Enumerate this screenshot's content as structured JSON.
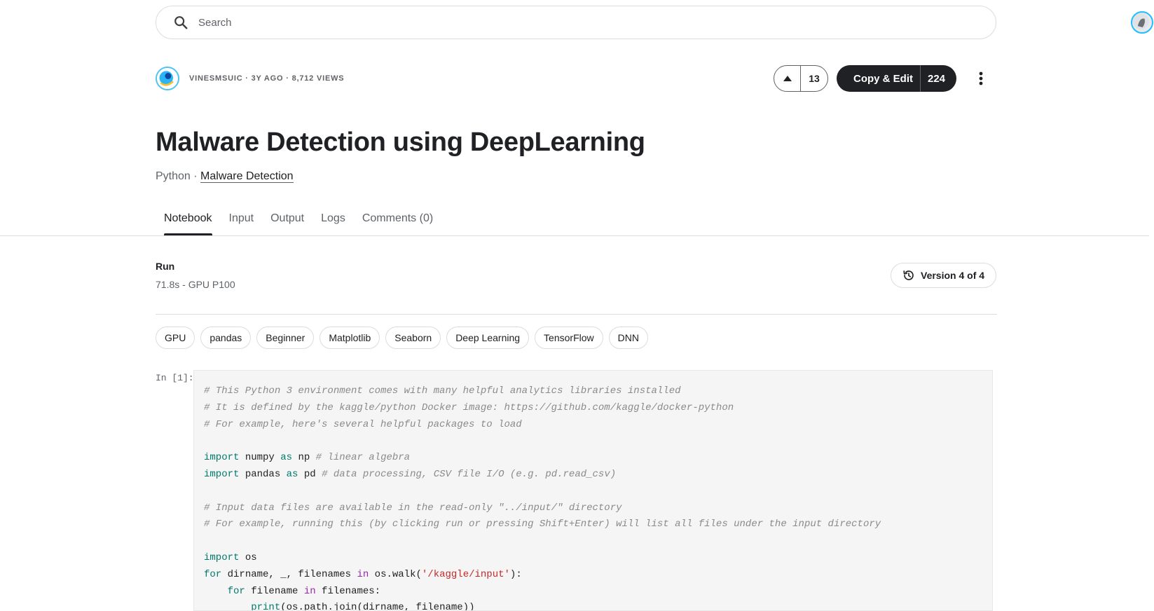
{
  "search": {
    "placeholder": "Search"
  },
  "author": {
    "meta": "VINESMSUIC · 3Y AGO · 8,712 VIEWS"
  },
  "votes": {
    "count": "13"
  },
  "copy_edit": {
    "label": "Copy & Edit",
    "count": "224"
  },
  "notebook": {
    "title": "Malware Detection using DeepLearning",
    "language": "Python",
    "separator": "·",
    "dataset": "Malware Detection"
  },
  "tabs": [
    {
      "label": "Notebook",
      "active": true
    },
    {
      "label": "Input",
      "active": false
    },
    {
      "label": "Output",
      "active": false
    },
    {
      "label": "Logs",
      "active": false
    },
    {
      "label": "Comments (0)",
      "active": false
    }
  ],
  "run": {
    "title": "Run",
    "meta": "71.8s - GPU P100"
  },
  "version": {
    "label": "Version 4 of 4"
  },
  "tags": [
    "GPU",
    "pandas",
    "Beginner",
    "Matplotlib",
    "Seaborn",
    "Deep Learning",
    "TensorFlow",
    "DNN"
  ],
  "cell": {
    "prompt": "In [1]:",
    "lines": [
      [
        {
          "t": "# This Python 3 environment comes with many helpful analytics libraries installed",
          "c": "comment"
        }
      ],
      [
        {
          "t": "# It is defined by the kaggle/python Docker image: https://github.com/kaggle/docker-python",
          "c": "comment"
        }
      ],
      [
        {
          "t": "# For example, here's several helpful packages to load",
          "c": "comment"
        }
      ],
      [],
      [
        {
          "t": "import",
          "c": "kw"
        },
        {
          "t": " numpy ",
          "c": ""
        },
        {
          "t": "as",
          "c": "kw"
        },
        {
          "t": " np ",
          "c": ""
        },
        {
          "t": "# linear algebra",
          "c": "comment"
        }
      ],
      [
        {
          "t": "import",
          "c": "kw"
        },
        {
          "t": " pandas ",
          "c": ""
        },
        {
          "t": "as",
          "c": "kw"
        },
        {
          "t": " pd ",
          "c": ""
        },
        {
          "t": "# data processing, CSV file I/O (e.g. pd.read_csv)",
          "c": "comment"
        }
      ],
      [],
      [
        {
          "t": "# Input data files are available in the read-only \"../input/\" directory",
          "c": "comment"
        }
      ],
      [
        {
          "t": "# For example, running this (by clicking run or pressing Shift+Enter) will list all files under the input directory",
          "c": "comment"
        }
      ],
      [],
      [
        {
          "t": "import",
          "c": "kw"
        },
        {
          "t": " os",
          "c": ""
        }
      ],
      [
        {
          "t": "for",
          "c": "kw"
        },
        {
          "t": " dirname, _, filenames ",
          "c": ""
        },
        {
          "t": "in",
          "c": "kw2"
        },
        {
          "t": " os.walk(",
          "c": ""
        },
        {
          "t": "'/kaggle/input'",
          "c": "str"
        },
        {
          "t": "):",
          "c": ""
        }
      ],
      [
        {
          "t": "    ",
          "c": ""
        },
        {
          "t": "for",
          "c": "kw"
        },
        {
          "t": " filename ",
          "c": ""
        },
        {
          "t": "in",
          "c": "kw2"
        },
        {
          "t": " filenames:",
          "c": ""
        }
      ],
      [
        {
          "t": "        ",
          "c": ""
        },
        {
          "t": "print",
          "c": "fn"
        },
        {
          "t": "(os.path.join(dirname, filename))",
          "c": ""
        }
      ]
    ]
  },
  "colors": {
    "accent": "#20beff",
    "dark": "#202124",
    "muted": "#5f6368",
    "border": "#dadce0"
  }
}
